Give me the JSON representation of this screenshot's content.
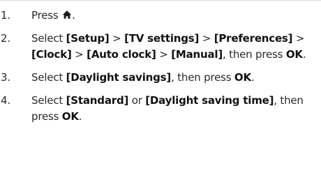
{
  "steps": [
    {
      "number": "1.",
      "text_before": "Press",
      "icon": "home-icon",
      "text_after": "."
    },
    {
      "number": "2.",
      "select_word": "Select",
      "menu_path": [
        "[Setup]",
        "[TV settings]",
        "[Preferences]",
        "[Clock]",
        "[Auto clock]",
        "[Manual]"
      ],
      "separator": ">",
      "then_press": ", then press",
      "key": "OK",
      "end": "."
    },
    {
      "number": "3.",
      "select_word": "Select",
      "option": "[Daylight savings]",
      "then_press": ", then press",
      "key": "OK",
      "end": "."
    },
    {
      "number": "4.",
      "select_word": "Select",
      "option_a": "[Standard]",
      "or_word": "or",
      "option_b": "[Daylight saving time]",
      "then_press": ", then press",
      "key": "OK",
      "end": "."
    }
  ]
}
